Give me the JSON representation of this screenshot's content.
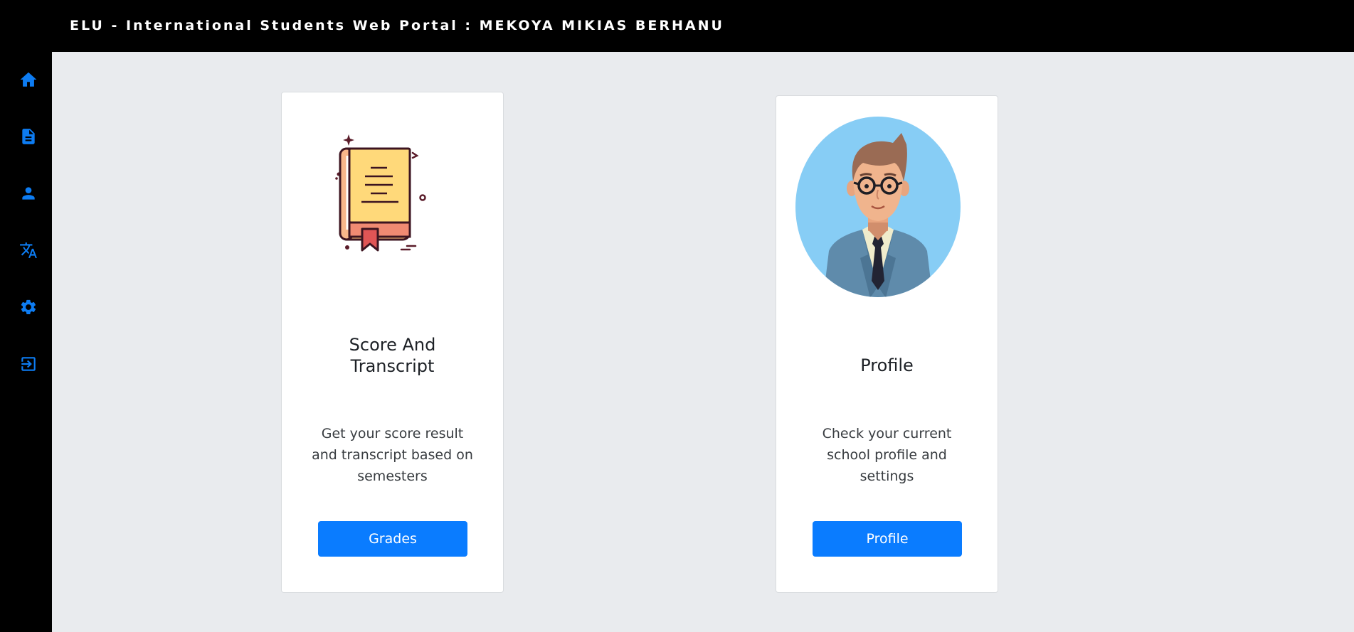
{
  "header": {
    "title": "ELU - International Students Web Portal : MEKOYA MIKIAS BERHANU"
  },
  "sidebar": {
    "items": [
      {
        "icon": "home-icon"
      },
      {
        "icon": "document-icon"
      },
      {
        "icon": "user-icon"
      },
      {
        "icon": "translate-icon"
      },
      {
        "icon": "gear-icon"
      },
      {
        "icon": "logout-icon"
      }
    ]
  },
  "cards": [
    {
      "title": "Score And\nTranscript",
      "description": "Get your score result and transcript based on semesters",
      "button_label": "Grades"
    },
    {
      "title": "Profile",
      "description": "Check your current school profile and settings",
      "button_label": "Profile"
    }
  ],
  "colors": {
    "accent": "#0a7cff",
    "icon": "#0d7cf2",
    "topbar": "#000000",
    "background": "#e9ebee"
  }
}
